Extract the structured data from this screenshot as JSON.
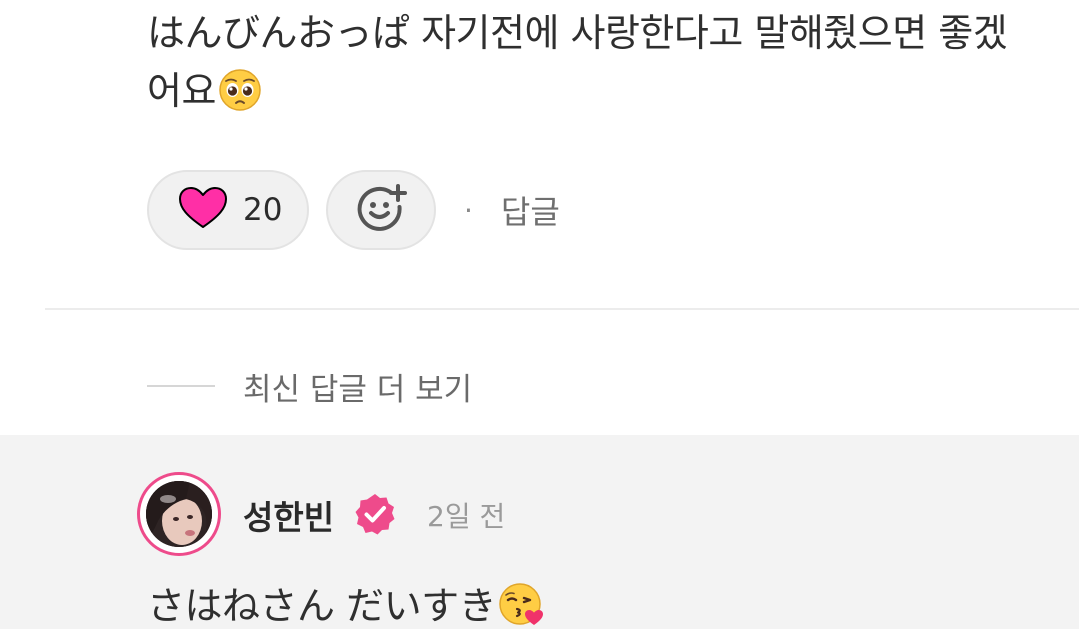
{
  "comment": {
    "text": "はんびんおっぱ 자기전에 사랑한다고 말해줬으면 좋겠어요",
    "emoji": "pleading-face-emoji"
  },
  "actions": {
    "like_icon": "heart-icon",
    "like_color": "#ff2fa6",
    "like_count": "20",
    "reaction_icon": "add-reaction-icon",
    "separator": "·",
    "reply_label": "답글"
  },
  "more_replies": {
    "label": "최신 답글 더 보기"
  },
  "reply": {
    "author": "성한빈",
    "verified_icon": "verified-badge-icon",
    "accent_color": "#ee4b8b",
    "time": "2일 전",
    "text": "さはねさん だいすき",
    "emoji": "face-blowing-kiss-emoji"
  }
}
